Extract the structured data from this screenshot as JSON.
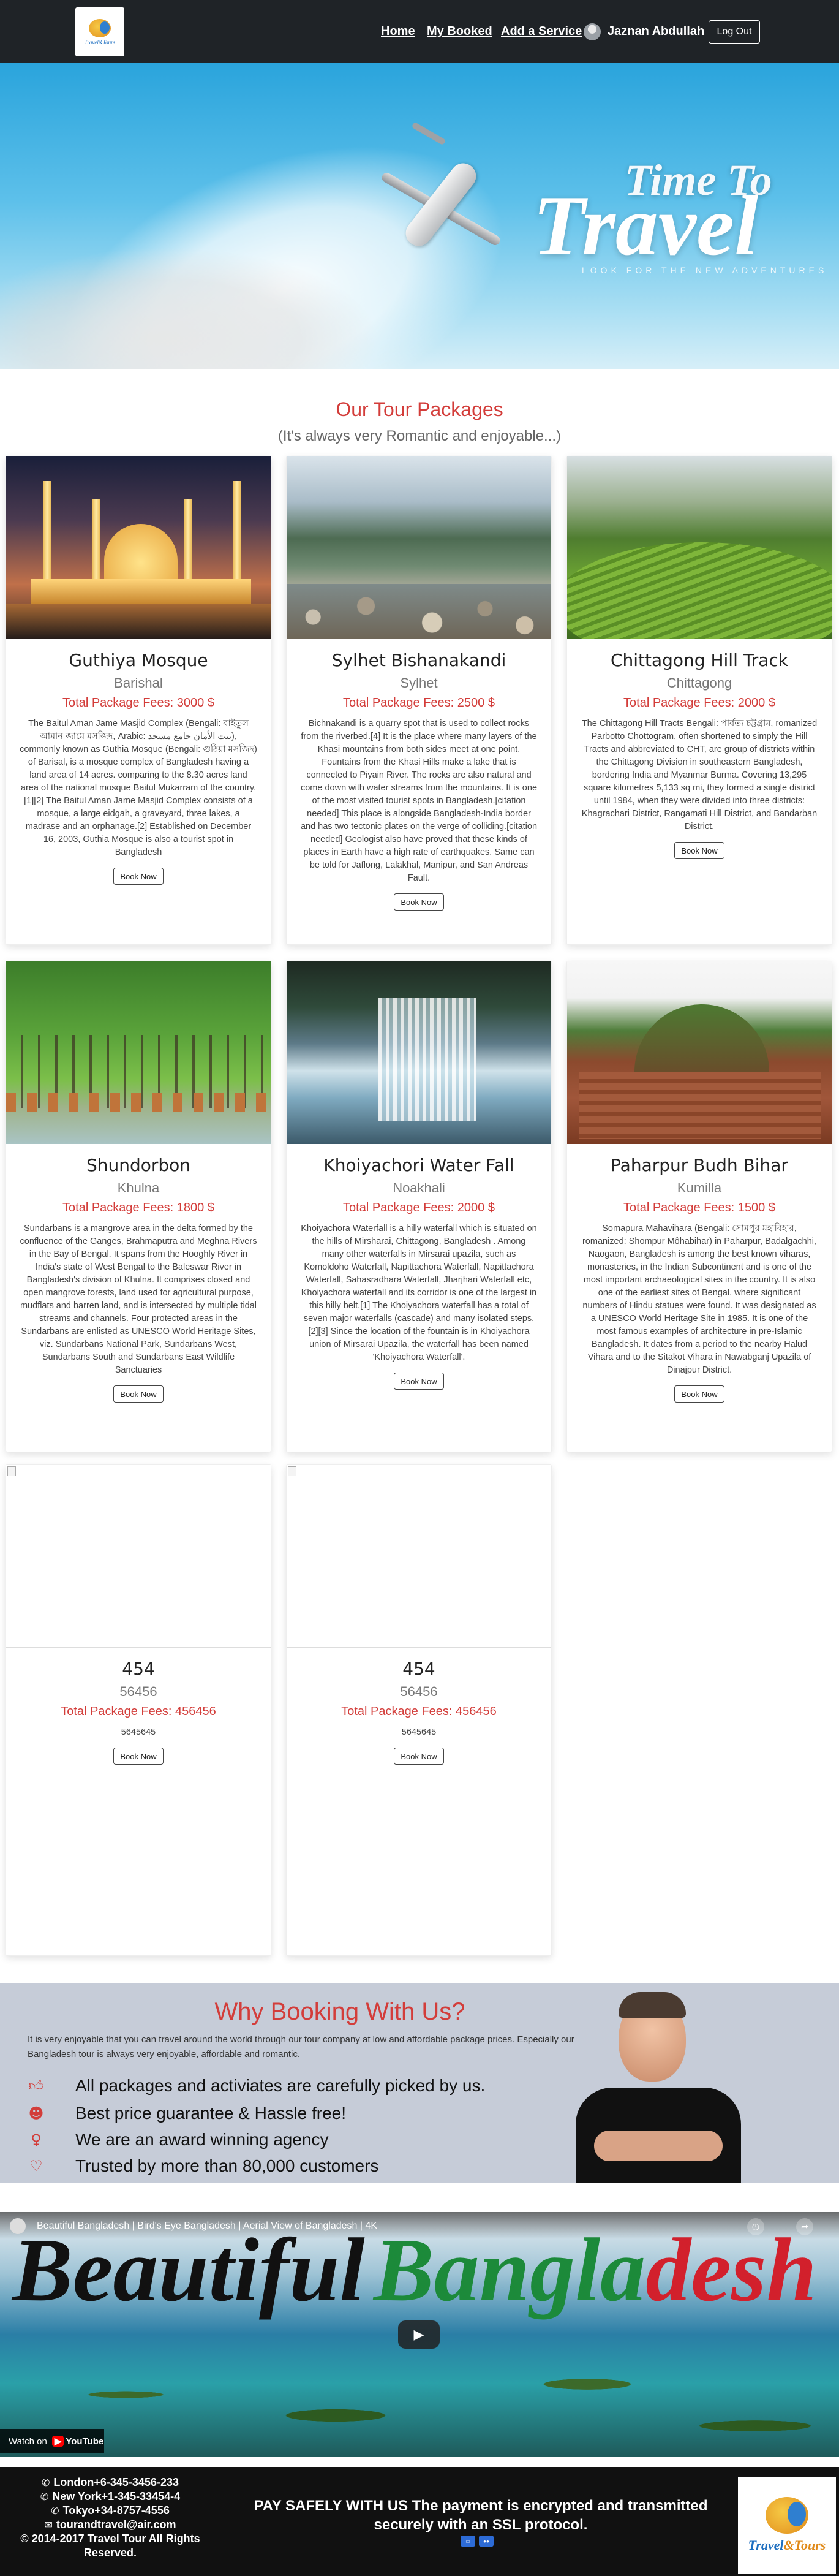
{
  "nav": {
    "logo_text": "Travel&Tours",
    "links": [
      "Home",
      "My Booked",
      "Add a Service"
    ],
    "user_name": "Jaznan Abdullah",
    "logout_label": "Log Out"
  },
  "hero": {
    "title_line1": "Time To",
    "title_line2": "Travel",
    "tagline": "LOOK FOR THE NEW ADVENTURES"
  },
  "packages_section": {
    "title": "Our Tour Packages",
    "subtitle": "(It's always very Romantic and enjoyable...)"
  },
  "packages": [
    {
      "name": "Guthiya Mosque",
      "location": "Barishal",
      "fee": "Total Package Fees: 3000 $",
      "description": "The Baitul Aman Jame Masjid Complex (Bengali: বাইতুল আমান জামে মসজিদ, Arabic: بيت الأمان جامع مسجد), commonly known as Guthia Mosque (Bengali: গুঠিয়া মসজিদ) of Barisal, is a mosque complex of Bangladesh having a land area of 14 acres. comparing to the 8.30 acres land area of the national mosque Baitul Mukarram of the country.[1][2] The Baitul Aman Jame Masjid Complex consists of a mosque, a large eidgah, a graveyard, three lakes, a madrase and an orphanage.[2] Established on December 16, 2003, Guthia Mosque is also a tourist spot in Bangladesh",
      "button": "Book Now"
    },
    {
      "name": "Sylhet Bishanakandi",
      "location": "Sylhet",
      "fee": "Total Package Fees: 2500 $",
      "description": "Bichnakandi is a quarry spot that is used to collect rocks from the riverbed.[4] It is the place where many layers of the Khasi mountains from both sides meet at one point. Fountains from the Khasi Hills make a lake that is connected to Piyain River. The rocks are also natural and come down with water streams from the mountains. It is one of the most visited tourist spots in Bangladesh.[citation needed] This place is alongside Bangladesh-India border and has two tectonic plates on the verge of colliding.[citation needed] Geologist also have proved that these kinds of places in Earth have a high rate of earthquakes. Same can be told for Jaflong, Lalakhal, Manipur, and San Andreas Fault.",
      "button": "Book Now"
    },
    {
      "name": "Chittagong Hill Track",
      "location": "Chittagong",
      "fee": "Total Package Fees: 2000 $",
      "description": "The Chittagong Hill Tracts Bengali: পার্বত্য চট্টগ্রাম, romanized Parbotto Chottogram, often shortened to simply the Hill Tracts and abbreviated to CHT, are group of districts within the Chittagong Division in southeastern Bangladesh, bordering India and Myanmar Burma. Covering 13,295 square kilometres 5,133 sq mi, they formed a single district until 1984, when they were divided into three districts: Khagrachari District, Rangamati Hill District, and Bandarban District.",
      "button": "Book Now"
    },
    {
      "name": "Shundorbon",
      "location": "Khulna",
      "fee": "Total Package Fees: 1800 $",
      "description": "Sundarbans is a mangrove area in the delta formed by the confluence of the Ganges, Brahmaputra and Meghna Rivers in the Bay of Bengal. It spans from the Hooghly River in India's state of West Bengal to the Baleswar River in Bangladesh's division of Khulna. It comprises closed and open mangrove forests, land used for agricultural purpose, mudflats and barren land, and is intersected by multiple tidal streams and channels. Four protected areas in the Sundarbans are enlisted as UNESCO World Heritage Sites, viz. Sundarbans National Park, Sundarbans West, Sundarbans South and Sundarbans East Wildlife Sanctuaries",
      "button": "Book Now"
    },
    {
      "name": "Khoiyachori Water Fall",
      "location": "Noakhali",
      "fee": "Total Package Fees: 2000 $",
      "description": "Khoiyachora Waterfall is a hilly waterfall which is situated on the hills of Mirsharai, Chittagong, Bangladesh . Among many other waterfalls in Mirsarai upazila, such as Komoldoho Waterfall, Napittachora Waterfall, Napittachora Waterfall, Sahasradhara Waterfall, Jharjhari Waterfall etc, Khoiyachora waterfall and its corridor is one of the largest in this hilly belt.[1] The Khoiyachora waterfall has a total of seven major waterfalls (cascade) and many isolated steps.[2][3] Since the location of the fountain is in Khoiyachora union of Mirsarai Upazila, the waterfall has been named 'Khoiyachora Waterfall'.",
      "button": "Book Now"
    },
    {
      "name": "Paharpur Budh Bihar",
      "location": "Kumilla",
      "fee": "Total Package Fees: 1500 $",
      "description": "Somapura Mahavihara (Bengali: সোমপুর মহাবিহার, romanized: Shompur Môhabihar) in Paharpur, Badalgachhi, Naogaon, Bangladesh is among the best known viharas, monasteries, in the Indian Subcontinent and is one of the most important archaeological sites in the country. It is also one of the earliest sites of Bengal. where significant numbers of Hindu statues were found. It was designated as a UNESCO World Heritage Site in 1985. It is one of the most famous examples of architecture in pre-Islamic Bangladesh. It dates from a period to the nearby Halud Vihara and to the Sitakot Vihara in Nawabganj Upazila of Dinajpur District.",
      "button": "Book Now"
    },
    {
      "name": "454",
      "location": "56456",
      "fee": "Total Package Fees: 456456",
      "description": "5645645",
      "button": "Book Now"
    },
    {
      "name": "454",
      "location": "56456",
      "fee": "Total Package Fees: 456456",
      "description": "5645645",
      "button": "Book Now"
    }
  ],
  "why": {
    "title": "Why Booking With Us?",
    "text": "It is very enjoyable that you can travel around the world through our tour company at low and affordable package prices. Especially our Bangladesh tour is always very enjoyable, affordable and romantic.",
    "items": [
      {
        "icon": "thumbs-up-icon",
        "label": "All packages and activiates are carefully picked by us."
      },
      {
        "icon": "people-icon",
        "label": "Best price guarantee & Hassle free!"
      },
      {
        "icon": "award-icon",
        "label": "We are an award winning agency"
      },
      {
        "icon": "heart-icon",
        "label": "Trusted by more than 80,000 customers"
      }
    ]
  },
  "video": {
    "title": "Beautiful Bangladesh | Bird's Eye Bangladesh | Aerial View of Bangladesh | 4K",
    "overlay_word1": "Beautiful",
    "overlay_word2_green": "Bangla",
    "overlay_word2_red": "desh",
    "watch_on": "Watch on",
    "youtube": "YouTube"
  },
  "footer": {
    "contacts": [
      "London+6-345-3456-233",
      "New York+1-345-33454-4",
      "Tokyo+34-8757-4556",
      "tourandtravel@air.com",
      "© 2014-2017 Travel Tour All Rights Reserved."
    ],
    "payment_text": "PAY SAFELY WITH US The payment is encrypted and transmitted securely with an SSL protocol.",
    "logo_text_blue": "Travel",
    "logo_text_orange": "&Tours"
  },
  "colors": {
    "accent": "#d33d3a",
    "nav_bg": "#1f2327",
    "why_bg": "#c6ccd8",
    "footer_bg": "#111111"
  }
}
